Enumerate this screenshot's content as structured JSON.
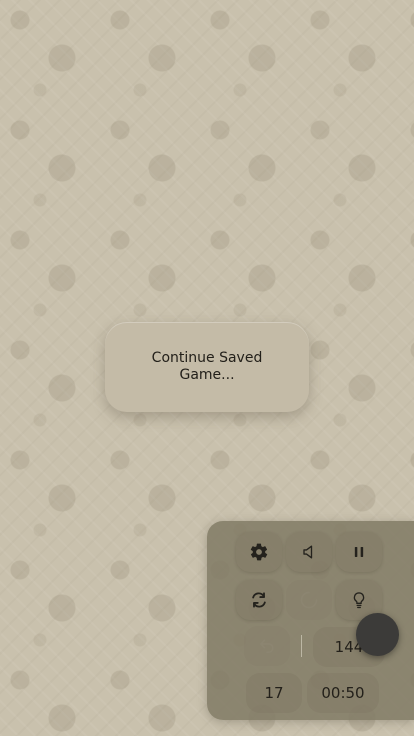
{
  "dialog": {
    "text": "Continue Saved Game..."
  },
  "controls": {
    "settings_icon": "gear-icon",
    "sound_icon": "speaker-icon",
    "pause_icon": "pause-icon",
    "restart_icon": "restart-icon",
    "loading_icon": "spinner-icon",
    "hint_icon": "lightbulb-icon",
    "undo_icon": "undo-icon"
  },
  "stats": {
    "score": "144",
    "moves": "17",
    "time": "00:50"
  },
  "colors": {
    "background": "#c9c1ad",
    "dialog": "#c4bba7",
    "panel": "#7e7762",
    "fab": "#3c3b39"
  }
}
